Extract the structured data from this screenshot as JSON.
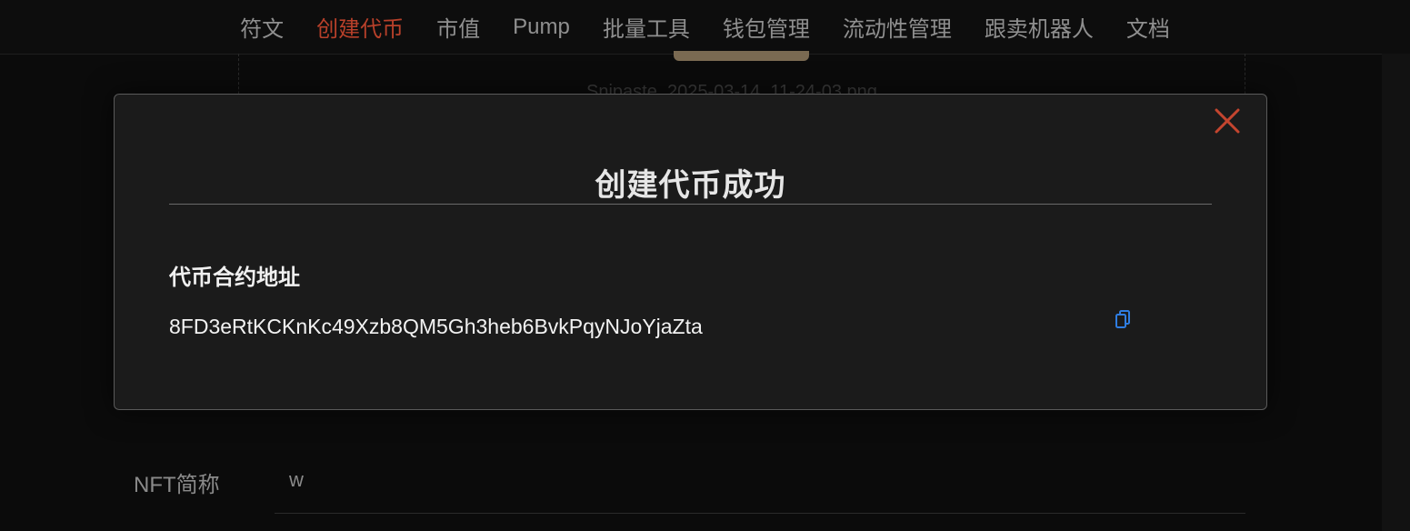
{
  "nav": {
    "items": [
      {
        "label": "符文"
      },
      {
        "label": "创建代币",
        "active": true
      },
      {
        "label": "市值"
      },
      {
        "label": "Pump"
      },
      {
        "label": "批量工具"
      },
      {
        "label": "钱包管理"
      },
      {
        "label": "流动性管理"
      },
      {
        "label": "跟卖机器人"
      },
      {
        "label": "文档"
      }
    ]
  },
  "background": {
    "filename": "Snipaste_2025-03-14_11-24-03.png",
    "nft_short_name_label": "NFT简称",
    "nft_short_name_value": "w"
  },
  "modal": {
    "title": "创建代币成功",
    "address_label": "代币合约地址",
    "address_value": "8FD3eRtKCKnKc49Xzb8QM5Gh3heb6BvkPqyNJoYjaZta",
    "close_icon": "close-icon",
    "copy_icon": "copy-icon"
  },
  "colors": {
    "accent": "#b8402a",
    "copy_icon": "#2f7de1",
    "background": "#0b0b0b",
    "modal_background": "#1b1b1b"
  }
}
